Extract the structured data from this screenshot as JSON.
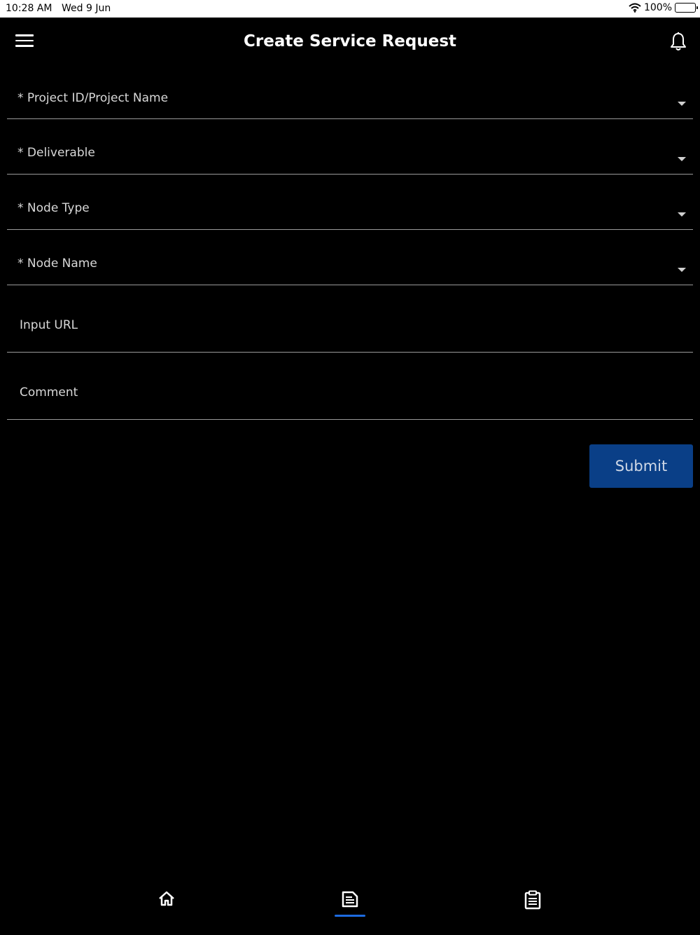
{
  "status_bar": {
    "time": "10:28 AM",
    "date": "Wed 9 Jun",
    "battery": "100%"
  },
  "header": {
    "title": "Create Service Request"
  },
  "form": {
    "fields": [
      {
        "label": "* Project ID/Project Name",
        "type": "dropdown"
      },
      {
        "label": "* Deliverable",
        "type": "dropdown"
      },
      {
        "label": "* Node Type",
        "type": "dropdown"
      },
      {
        "label": "* Node Name",
        "type": "dropdown"
      },
      {
        "label": "Input URL",
        "type": "text"
      },
      {
        "label": "Comment",
        "type": "text"
      }
    ],
    "submit_label": "Submit"
  },
  "bottom_nav": {
    "items": [
      {
        "icon": "home-icon"
      },
      {
        "icon": "document-icon",
        "active": true
      },
      {
        "icon": "clipboard-icon"
      }
    ]
  },
  "colors": {
    "background": "#000000",
    "submit": "#0a3f87",
    "nav_active": "#1d6be0"
  }
}
